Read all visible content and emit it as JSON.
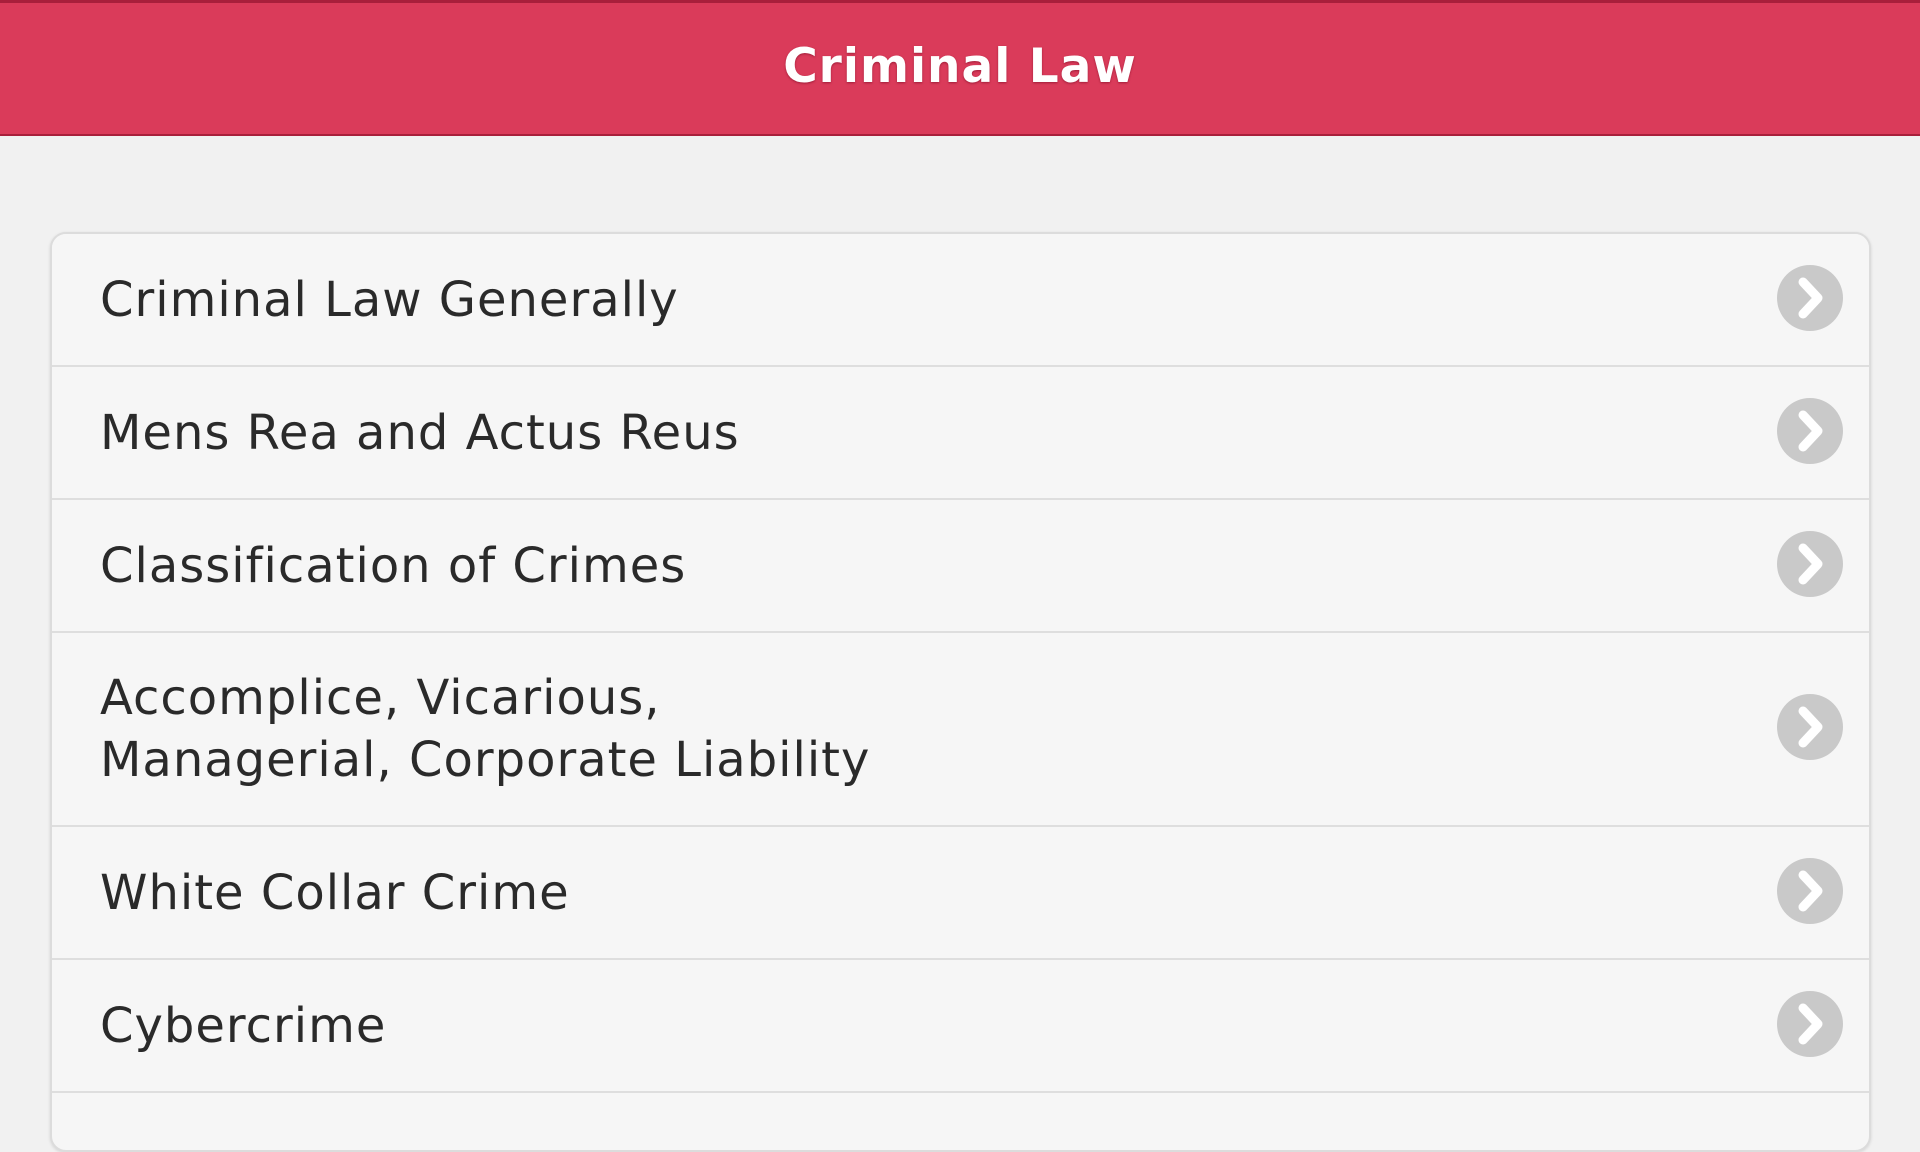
{
  "header": {
    "title": "Criminal Law",
    "color": "#da3b5a"
  },
  "menu": {
    "items": [
      {
        "label": "Criminal Law Generally",
        "icon": "chevron-right-icon"
      },
      {
        "label": "Mens Rea and Actus Reus",
        "icon": "chevron-right-icon"
      },
      {
        "label": "Classification of Crimes",
        "icon": "chevron-right-icon"
      },
      {
        "label": "Accomplice, Vicarious,\nManagerial, Corporate Liability",
        "icon": "chevron-right-icon"
      },
      {
        "label": "White Collar Crime",
        "icon": "chevron-right-icon"
      },
      {
        "label": "Cybercrime",
        "icon": "chevron-right-icon"
      }
    ]
  }
}
